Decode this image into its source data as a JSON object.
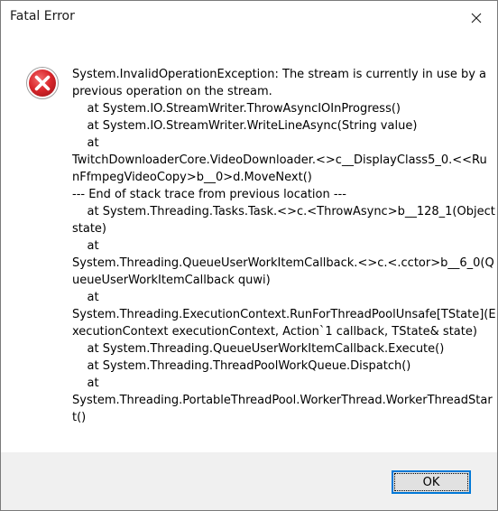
{
  "dialog": {
    "title": "Fatal Error",
    "icon": "error-icon",
    "ok_label": "OK",
    "colors": {
      "accent": "#0078d7",
      "error_red": "#d9262b",
      "footer_bg": "#f0f0f0"
    },
    "message_lines": [
      "System.InvalidOperationException: The stream is currently in use by a",
      "previous operation on the stream.",
      "    at System.IO.StreamWriter.ThrowAsyncIOInProgress()",
      "    at System.IO.StreamWriter.WriteLineAsync(String value)",
      "    at",
      "TwitchDownloaderCore.VideoDownloader.<>c__DisplayClass5_0.<<Ru",
      "nFfmpegVideoCopy>b__0>d.MoveNext()",
      "--- End of stack trace from previous location ---",
      "    at System.Threading.Tasks.Task.<>c.<ThrowAsync>b__128_1(Object",
      "state)",
      "    at",
      "System.Threading.QueueUserWorkItemCallback.<>c.<.cctor>b__6_0(Q",
      "ueueUserWorkItemCallback quwi)",
      "    at",
      "System.Threading.ExecutionContext.RunForThreadPoolUnsafe[TState](E",
      "xecutionContext executionContext, Action`1 callback, TState& state)",
      "    at System.Threading.QueueUserWorkItemCallback.Execute()",
      "    at System.Threading.ThreadPoolWorkQueue.Dispatch()",
      "    at",
      "System.Threading.PortableThreadPool.WorkerThread.WorkerThreadStar",
      "t()"
    ]
  }
}
